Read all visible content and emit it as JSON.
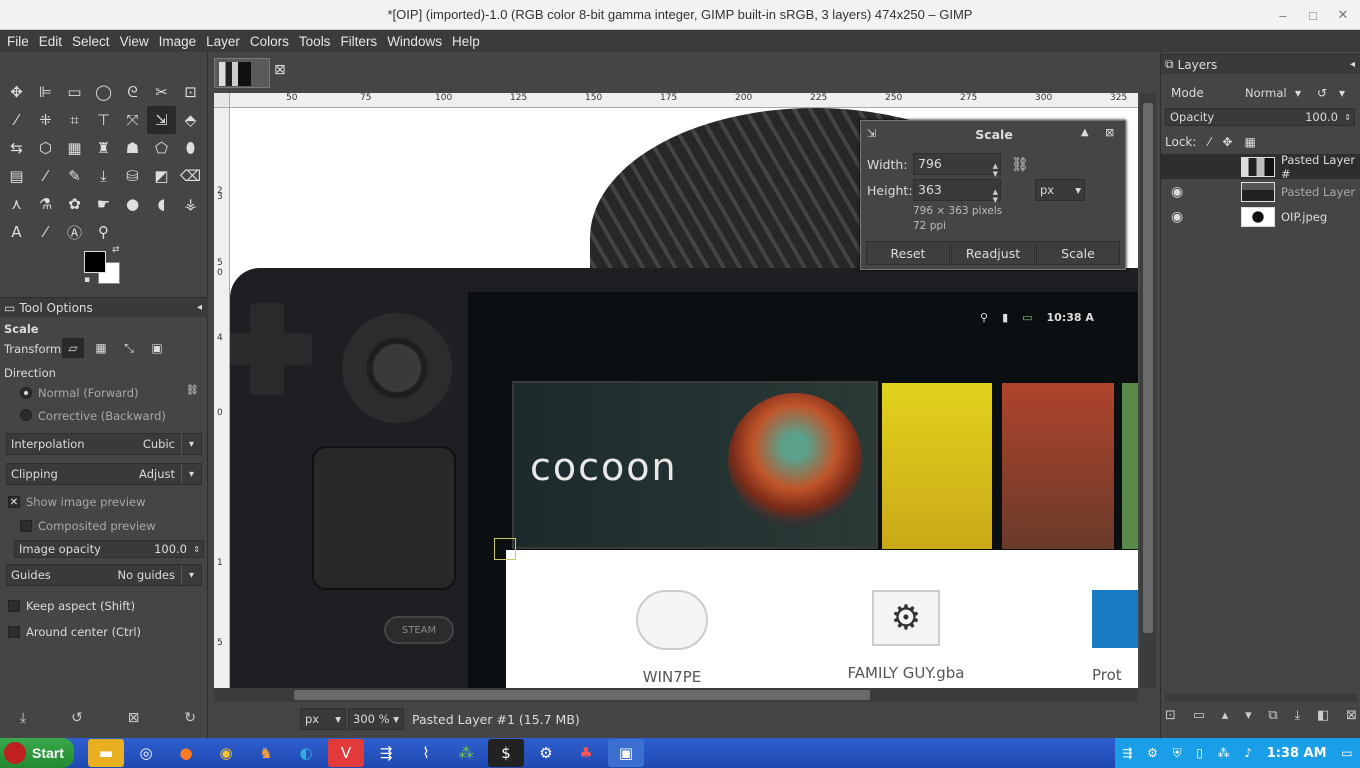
{
  "window": {
    "title": "*[OIP] (imported)-1.0 (RGB color 8-bit gamma integer, GIMP built-in sRGB, 3 layers) 474x250 – GIMP",
    "minimize": "–",
    "maximize": "□",
    "close": "✕"
  },
  "menu": [
    "File",
    "Edit",
    "Select",
    "View",
    "Image",
    "Layer",
    "Colors",
    "Tools",
    "Filters",
    "Windows",
    "Help"
  ],
  "tool_options": {
    "tab_label": "Tool Options",
    "tool_name": "Scale",
    "transform_label": "Transform:",
    "direction_label": "Direction",
    "direction_normal": "Normal (Forward)",
    "direction_corrective": "Corrective (Backward)",
    "interpolation_label": "Interpolation",
    "interpolation_value": "Cubic",
    "clipping_label": "Clipping",
    "clipping_value": "Adjust",
    "show_preview": "Show image preview",
    "composited_preview": "Composited preview",
    "image_opacity_label": "Image opacity",
    "image_opacity_value": "100.0",
    "guides_label": "Guides",
    "guides_value": "No guides",
    "keep_aspect": "Keep aspect (Shift)",
    "around_center": "Around center (Ctrl)"
  },
  "ruler": {
    "top_labels": [
      "50",
      "75",
      "100",
      "125",
      "150",
      "175",
      "200",
      "225",
      "250",
      "275",
      "300",
      "325"
    ],
    "left_labels": [
      "2",
      "3",
      "5",
      "0",
      "4",
      "0",
      "1",
      "5"
    ]
  },
  "canvas": {
    "hero_logo": "cocoon",
    "steam_button": "STEAM",
    "status_time": "10:38 A",
    "app1": "WIN7PE",
    "app2": "FAMILY GUY.gba",
    "app3": "Prot"
  },
  "scale_dialog": {
    "title": "Scale",
    "width_label": "Width:",
    "width_value": "796",
    "height_label": "Height:",
    "height_value": "363",
    "unit": "px",
    "size_info": "796 × 363 pixels",
    "resolution_info": "72 ppi",
    "reset": "Reset",
    "readjust": "Readjust",
    "scale": "Scale"
  },
  "statusbar": {
    "unit": "px",
    "zoom": "300 %",
    "info": "Pasted Layer #1 (15.7 MB)"
  },
  "layers": {
    "tab_label": "Layers",
    "mode_label": "Mode",
    "mode_value": "Normal",
    "opacity_label": "Opacity",
    "opacity_value": "100.0",
    "lock_label": "Lock:",
    "items": [
      {
        "name": "Pasted Layer #",
        "visible": false
      },
      {
        "name": "Pasted Layer",
        "visible": true
      },
      {
        "name": "OIP.jpeg",
        "visible": true
      }
    ]
  },
  "taskbar": {
    "start": "Start",
    "clock": "1:38 AM",
    "colors": {
      "bar": "#1e49b0",
      "start": "#238a32",
      "tray": "#1a9ee8"
    }
  }
}
